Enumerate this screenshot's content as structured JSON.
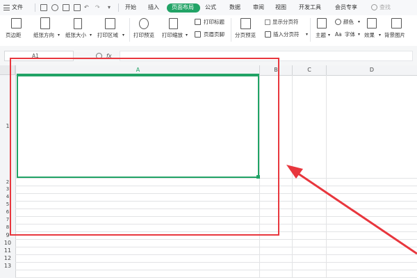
{
  "menu": {
    "file_label": "文件",
    "tabs": [
      "开始",
      "插入",
      "页面布局",
      "公式",
      "数据",
      "审阅",
      "视图",
      "开发工具",
      "会员专享"
    ],
    "active_tab": "页面布局",
    "search_placeholder": "查找"
  },
  "ribbon": {
    "margins": "页边距",
    "orientation": "纸张方向",
    "size": "纸张大小",
    "print_area": "打印区域",
    "print_preview": "打印预览",
    "print_scale": "打印缩放",
    "print_titles": "打印标题",
    "header_footer": "页眉页脚",
    "page_break_preview": "分页预览",
    "show_page_breaks": "显示分页符",
    "insert_page_break": "插入分页符",
    "theme": "主题",
    "colors": "颜色",
    "fonts": "字体",
    "effects": "效果",
    "background": "背景图片"
  },
  "formula_bar": {
    "name_box": "A1",
    "fx": "fx",
    "value": ""
  },
  "sheet": {
    "columns": [
      "A",
      "B",
      "C",
      "D"
    ],
    "active_column": "A",
    "row_numbers": [
      "1",
      "2",
      "3",
      "4",
      "5",
      "6",
      "7",
      "8",
      "9",
      "10",
      "11",
      "12",
      "13"
    ]
  },
  "colors": {
    "accent_green": "#21a366",
    "annotation_red": "#e8363d"
  }
}
